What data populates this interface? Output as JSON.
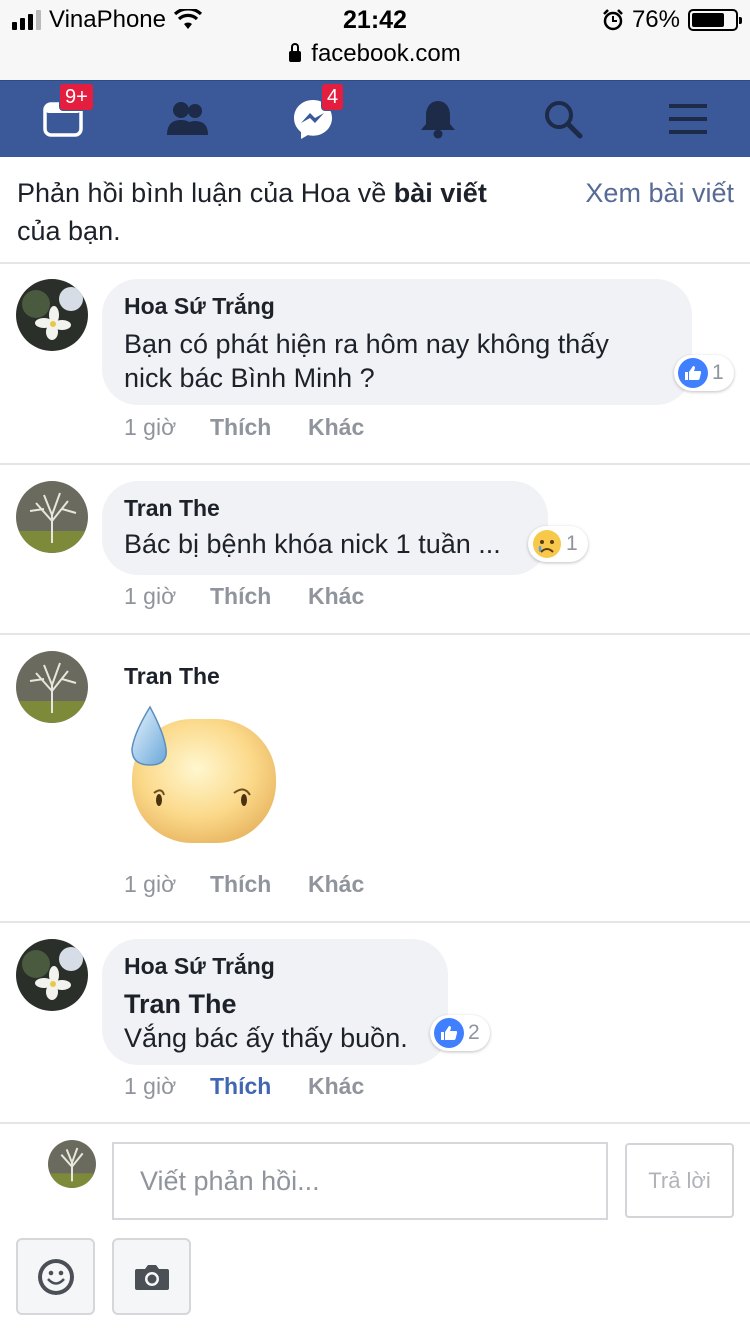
{
  "status": {
    "carrier": "VinaPhone",
    "time": "21:42",
    "battery": "76%",
    "battery_level": 0.76
  },
  "url": "facebook.com",
  "nav": {
    "feed_badge": "9+",
    "messages_badge": "4"
  },
  "header": {
    "text_prefix": "Phản hồi bình luận của Hoa về ",
    "text_bold": "bài viết",
    "text_suffix": "của bạn.",
    "link": "Xem bài viết"
  },
  "comments": [
    {
      "author": "Hoa Sứ Trắng",
      "text_line1": "Bạn có phát hiện ra hôm nay không thấy",
      "text_line2": "nick bác Bình Minh ?",
      "reaction_icon": "like-icon",
      "reaction_count": "1",
      "time": "1 giờ",
      "like": "Thích",
      "more": "Khác"
    },
    {
      "author": "Tran The",
      "text": "Bác bị bệnh khóa nick 1 tuần ...",
      "reaction_icon": "sad-face-icon",
      "reaction_count": "1",
      "time": "1 giờ",
      "like": "Thích",
      "more": "Khác"
    },
    {
      "author": "Tran The",
      "sticker": "sweat-drop-face-sticker",
      "time": "1 giờ",
      "like": "Thích",
      "more": "Khác"
    },
    {
      "author": "Hoa Sứ Trắng",
      "mention": "Tran The",
      "text": "Vắng bác ấy thấy buồn.",
      "reaction_icon": "like-icon",
      "reaction_count": "2",
      "time": "1 giờ",
      "like": "Thích",
      "more": "Khác",
      "liked": true
    }
  ],
  "reply": {
    "placeholder": "Viết phản hồi...",
    "button": "Trả lời"
  },
  "colors": {
    "nav_bg": "#3b5998",
    "badge": "#e41e3f",
    "link": "#576b95",
    "like_active": "#4267b2",
    "reaction_blue": "#4080ff"
  }
}
